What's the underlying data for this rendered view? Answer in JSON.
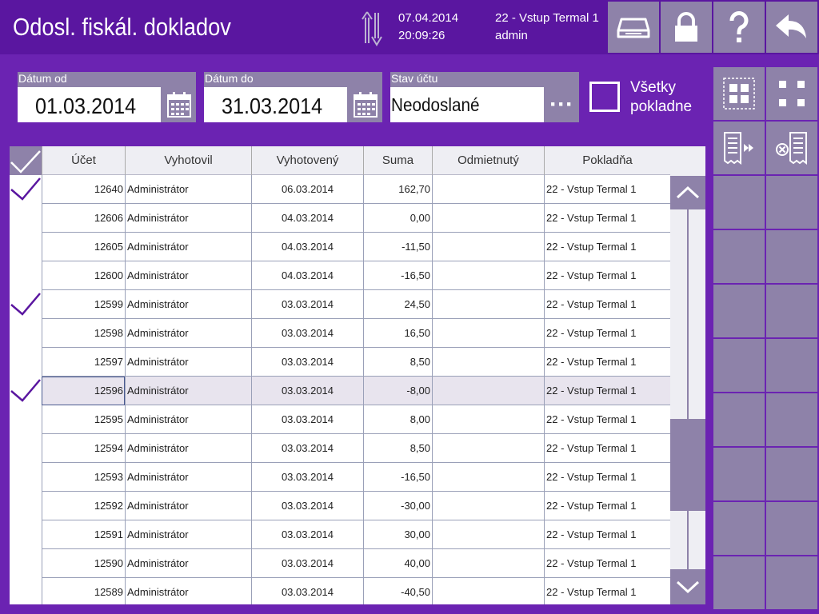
{
  "header": {
    "title": "Odosl. fiskál. dokladov",
    "date": "07.04.2014",
    "time": "20:09:26",
    "terminal": "22 - Vstup Termal 1",
    "user": "admin",
    "buttons": [
      "printer-icon",
      "lock-icon",
      "help-icon",
      "back-icon"
    ]
  },
  "filters": {
    "date_from": {
      "label": "Dátum od",
      "value": "01.03.2014"
    },
    "date_to": {
      "label": "Dátum do",
      "value": "31.03.2014"
    },
    "status": {
      "label": "Stav účtu",
      "value": "Neodoslané",
      "more": "···"
    },
    "all_registers": {
      "label_line1": "Všetky",
      "label_line2": "pokladne",
      "checked": false
    }
  },
  "table": {
    "columns": [
      "Účet",
      "Vyhotovil",
      "Vyhotovený",
      "Suma",
      "Odmietnutý",
      "Pokladňa"
    ],
    "rows": [
      {
        "checked": true,
        "ucet": "12640",
        "vyhotovil": "Administrátor",
        "datum": "06.03.2014",
        "suma": "162,70",
        "odmietnuty": "",
        "pokladna": "22 - Vstup Termal 1"
      },
      {
        "checked": false,
        "ucet": "12606",
        "vyhotovil": "Administrátor",
        "datum": "04.03.2014",
        "suma": "0,00",
        "odmietnuty": "",
        "pokladna": "22 - Vstup Termal 1"
      },
      {
        "checked": false,
        "ucet": "12605",
        "vyhotovil": "Administrátor",
        "datum": "04.03.2014",
        "suma": "-11,50",
        "odmietnuty": "",
        "pokladna": "22 - Vstup Termal 1"
      },
      {
        "checked": false,
        "ucet": "12600",
        "vyhotovil": "Administrátor",
        "datum": "04.03.2014",
        "suma": "-16,50",
        "odmietnuty": "",
        "pokladna": "22 - Vstup Termal 1"
      },
      {
        "checked": true,
        "ucet": "12599",
        "vyhotovil": "Administrátor",
        "datum": "03.03.2014",
        "suma": "24,50",
        "odmietnuty": "",
        "pokladna": "22 - Vstup Termal 1"
      },
      {
        "checked": false,
        "ucet": "12598",
        "vyhotovil": "Administrátor",
        "datum": "03.03.2014",
        "suma": "16,50",
        "odmietnuty": "",
        "pokladna": "22 - Vstup Termal 1"
      },
      {
        "checked": false,
        "ucet": "12597",
        "vyhotovil": "Administrátor",
        "datum": "03.03.2014",
        "suma": "8,50",
        "odmietnuty": "",
        "pokladna": "22 - Vstup Termal 1"
      },
      {
        "checked": true,
        "selected": true,
        "ucet": "12596",
        "vyhotovil": "Administrátor",
        "datum": "03.03.2014",
        "suma": "-8,00",
        "odmietnuty": "",
        "pokladna": "22 - Vstup Termal 1"
      },
      {
        "checked": false,
        "ucet": "12595",
        "vyhotovil": "Administrátor",
        "datum": "03.03.2014",
        "suma": "8,00",
        "odmietnuty": "",
        "pokladna": "22 - Vstup Termal 1"
      },
      {
        "checked": false,
        "ucet": "12594",
        "vyhotovil": "Administrátor",
        "datum": "03.03.2014",
        "suma": "8,50",
        "odmietnuty": "",
        "pokladna": "22 - Vstup Termal 1"
      },
      {
        "checked": false,
        "ucet": "12593",
        "vyhotovil": "Administrátor",
        "datum": "03.03.2014",
        "suma": "-16,50",
        "odmietnuty": "",
        "pokladna": "22 - Vstup Termal 1"
      },
      {
        "checked": false,
        "ucet": "12592",
        "vyhotovil": "Administrátor",
        "datum": "03.03.2014",
        "suma": "-30,00",
        "odmietnuty": "",
        "pokladna": "22 - Vstup Termal 1"
      },
      {
        "checked": false,
        "ucet": "12591",
        "vyhotovil": "Administrátor",
        "datum": "03.03.2014",
        "suma": "30,00",
        "odmietnuty": "",
        "pokladna": "22 - Vstup Termal 1"
      },
      {
        "checked": false,
        "ucet": "12590",
        "vyhotovil": "Administrátor",
        "datum": "03.03.2014",
        "suma": "40,00",
        "odmietnuty": "",
        "pokladna": "22 - Vstup Termal 1"
      },
      {
        "checked": false,
        "ucet": "12589",
        "vyhotovil": "Administrátor",
        "datum": "03.03.2014",
        "suma": "-40,50",
        "odmietnuty": "",
        "pokladna": "22 - Vstup Termal 1"
      }
    ]
  },
  "toolbar": {
    "tools": [
      "select-all-icon",
      "deselect-all-icon",
      "send-receipt-icon",
      "cancel-receipt-icon"
    ]
  },
  "colors": {
    "background": "#6b23b2",
    "header": "#5a16a0",
    "button": "#8e82a9",
    "check": "#5a16a0"
  }
}
